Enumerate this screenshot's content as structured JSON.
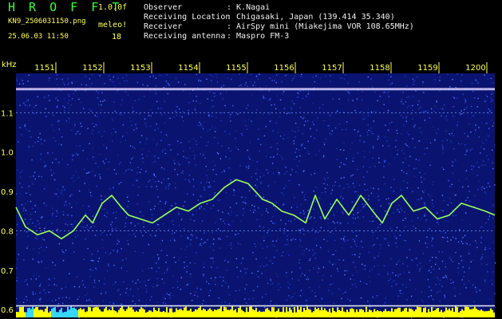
{
  "header": {
    "brand": "H R O F F T",
    "version": "1.0.0f",
    "filename": "KN9_2506031150.png",
    "mode": "meleo!",
    "datetime": "25.06.03 11:50",
    "count": "18"
  },
  "meta": [
    {
      "label": "Observer",
      "value": ": K.Nagai"
    },
    {
      "label": "Receiving Location",
      "value": ": Chigasaki, Japan (139.414 35.340)"
    },
    {
      "label": "Receiver",
      "value": ": AirSpy mini (Miakejima VOR 108.65MHz)"
    },
    {
      "label": "Receiving antenna",
      "value": ": Maspro FM-3"
    }
  ],
  "colors": {
    "background": "#000000",
    "noise": "#1f2fa8",
    "text": "#ffff55",
    "trace": "#9aff5a",
    "baseline": "#ffff00",
    "carrier": "#c8c8ff"
  },
  "chart_data": {
    "type": "line",
    "ylabel": "kHz",
    "x_ticks": [
      "1151",
      "1152",
      "1153",
      "1154",
      "1155",
      "1156",
      "1157",
      "1158",
      "1159",
      "1200"
    ],
    "y_ticks": [
      "1.1",
      "1.0",
      "0.9",
      "0.8",
      "0.7",
      "0.6"
    ],
    "x_range": [
      "11:50:30",
      "12:00:30"
    ],
    "ylim": [
      0.58,
      1.2
    ],
    "carrier_khz": 1.16,
    "reference_lines_khz": [
      1.1,
      0.8
    ],
    "series": [
      {
        "x_minutes": [
          0.0,
          0.2,
          0.45,
          0.7,
          0.95,
          1.2,
          1.45,
          1.6,
          1.8,
          2.0,
          2.2,
          2.35,
          2.6,
          2.85,
          3.1,
          3.35,
          3.6,
          3.85,
          4.1,
          4.35,
          4.6,
          4.85,
          5.0,
          5.15,
          5.35,
          5.55,
          5.8,
          6.05,
          6.25,
          6.45,
          6.7,
          6.95,
          7.2,
          7.45,
          7.65,
          7.85,
          8.05,
          8.3,
          8.55,
          8.8,
          9.05,
          9.3,
          9.55,
          9.8,
          10.0
        ],
        "y_khz": [
          0.86,
          0.81,
          0.79,
          0.8,
          0.78,
          0.8,
          0.84,
          0.82,
          0.87,
          0.89,
          0.86,
          0.84,
          0.83,
          0.82,
          0.84,
          0.86,
          0.85,
          0.87,
          0.88,
          0.91,
          0.93,
          0.92,
          0.9,
          0.88,
          0.87,
          0.85,
          0.84,
          0.82,
          0.89,
          0.83,
          0.88,
          0.84,
          0.89,
          0.85,
          0.82,
          0.87,
          0.89,
          0.85,
          0.86,
          0.83,
          0.84,
          0.87,
          0.86,
          0.85,
          0.84
        ]
      }
    ],
    "baseline_bars": {
      "description": "yellow signal-strength strip along bottom",
      "level": 0.61
    }
  }
}
